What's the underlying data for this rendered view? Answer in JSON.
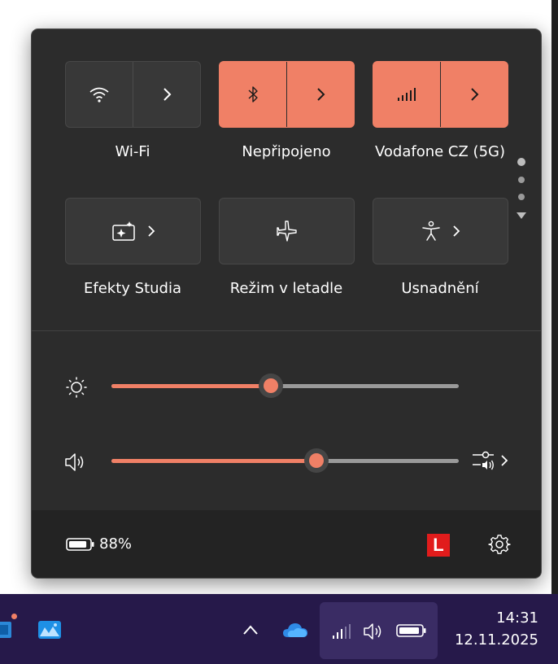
{
  "quick_settings": {
    "tiles": [
      {
        "label": "Wi-Fi",
        "icon": "wifi-icon",
        "active": false
      },
      {
        "label": "Nepřipojeno",
        "icon": "bluetooth-icon",
        "active": true
      },
      {
        "label": "Vodafone CZ (5G)",
        "icon": "cellular-icon",
        "active": true
      },
      {
        "label": "Efekty Studia",
        "icon": "studio-effects-icon",
        "active": false
      },
      {
        "label": "Režim v letadle",
        "icon": "airplane-icon",
        "active": false
      },
      {
        "label": "Usnadnění",
        "icon": "accessibility-icon",
        "active": false
      }
    ],
    "page_indicator": {
      "pages": 4,
      "current": 1
    },
    "brightness": {
      "icon": "brightness-icon",
      "level": 0.46
    },
    "volume": {
      "icon": "speaker-icon",
      "level": 0.59
    }
  },
  "footer": {
    "battery_percent": "88%",
    "battery_level": 0.88,
    "app_badge_letter": "L",
    "app_badge_color": "#e11c1c"
  },
  "taskbar": {
    "time": "14:31",
    "date": "12.11.2025"
  },
  "colors": {
    "accent": "#f08066",
    "panel_bg": "#2c2c2c",
    "taskbar_bg": "#26194a"
  }
}
